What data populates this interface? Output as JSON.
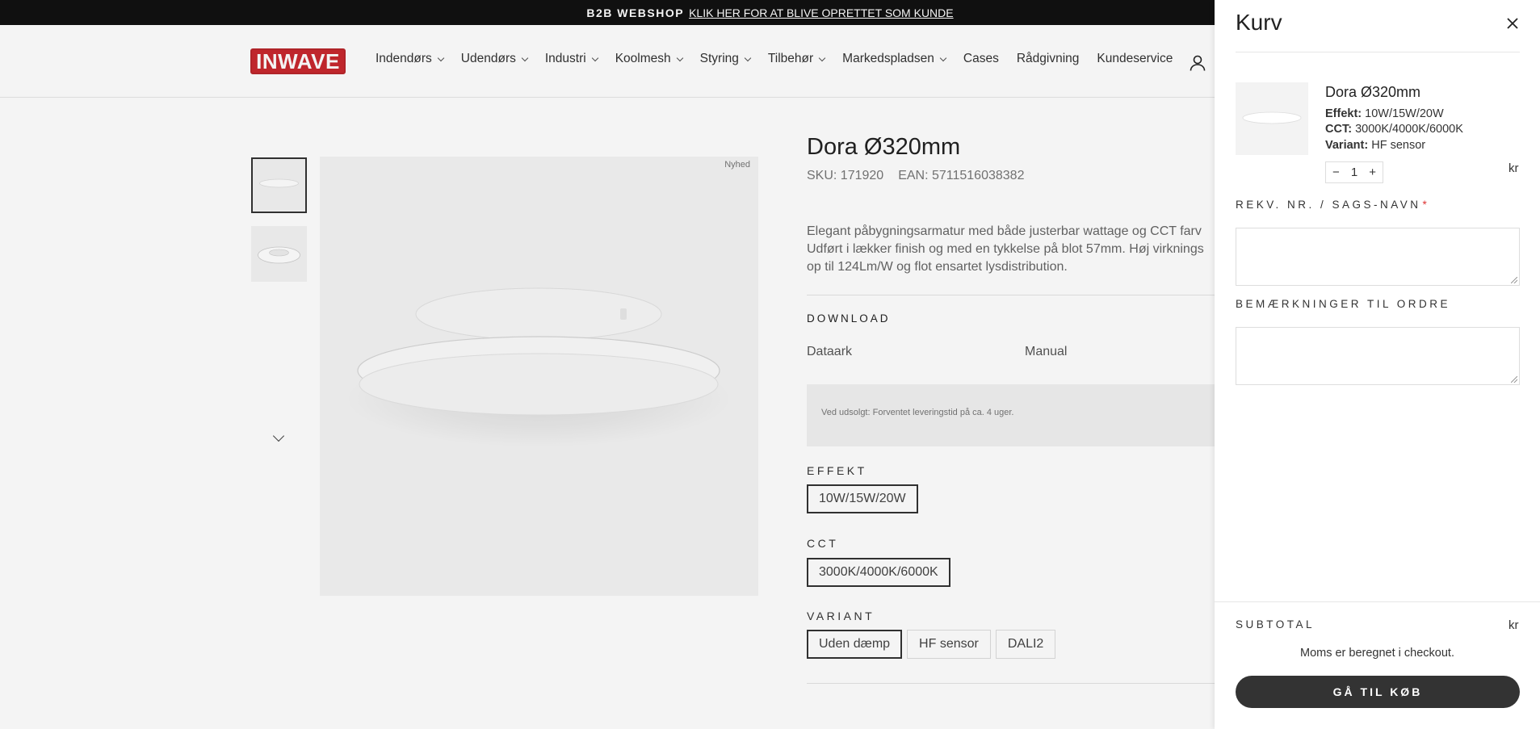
{
  "announcement": {
    "label": "B2B WEBSHOP",
    "link": "KLIK HER FOR AT BLIVE OPRETTET SOM KUNDE"
  },
  "header": {
    "logo_text": "INWAVE",
    "nav": [
      {
        "label": "Indendørs",
        "dropdown": true
      },
      {
        "label": "Udendørs",
        "dropdown": true
      },
      {
        "label": "Industri",
        "dropdown": true
      },
      {
        "label": "Koolmesh",
        "dropdown": true
      },
      {
        "label": "Styring",
        "dropdown": true
      },
      {
        "label": "Tilbehør",
        "dropdown": true
      },
      {
        "label": "Markedspladsen",
        "dropdown": true
      },
      {
        "label": "Cases",
        "dropdown": false
      },
      {
        "label": "Rådgivning",
        "dropdown": false
      },
      {
        "label": "Kundeservice",
        "dropdown": false
      }
    ],
    "account_icon": "user-icon"
  },
  "product": {
    "badge": "Nyhed",
    "title": "Dora Ø320mm",
    "sku": "SKU: 171920",
    "ean": "EAN: 5711516038382",
    "description": [
      "Elegant påbygningsarmatur med både justerbar wattage og CCT farv",
      "Udført i lækker finish og med en tykkelse på blot 57mm. Høj virknings",
      "op til 124Lm/W og flot ensartet lysdistribution."
    ],
    "download_label": "DOWNLOAD",
    "downloads": [
      "Dataark",
      "Manual"
    ],
    "stock_note": "Ved udsolgt: Forventet leveringstid på ca. 4 uger.",
    "options": {
      "effekt": {
        "label": "EFFEKT",
        "values": [
          "10W/15W/20W"
        ],
        "selected": "10W/15W/20W"
      },
      "cct": {
        "label": "CCT",
        "values": [
          "3000K/4000K/6000K"
        ],
        "selected": "3000K/4000K/6000K"
      },
      "variant": {
        "label": "VARIANT",
        "values": [
          "Uden dæmp",
          "HF sensor",
          "DALI2"
        ],
        "selected": "Uden dæmp"
      }
    }
  },
  "cart": {
    "title": "Kurv",
    "close_icon": "close-icon",
    "item": {
      "name": "Dora Ø320mm",
      "props": [
        {
          "key": "Effekt:",
          "value": "10W/15W/20W"
        },
        {
          "key": "CCT:",
          "value": "3000K/4000K/6000K"
        },
        {
          "key": "Variant:",
          "value": "HF sensor"
        }
      ],
      "qty_minus": "−",
      "quantity": "1",
      "qty_plus": "+",
      "price": "kr"
    },
    "rekv_label": "REKV. NR. / SAGS-NAVN",
    "required_mark": "*",
    "notes_label": "BEMÆRKNINGER TIL ORDRE",
    "subtotal_label": "SUBTOTAL",
    "subtotal_value": "kr",
    "tax_note": "Moms er beregnet i checkout.",
    "checkout_label": "GÅ TIL KØB"
  }
}
